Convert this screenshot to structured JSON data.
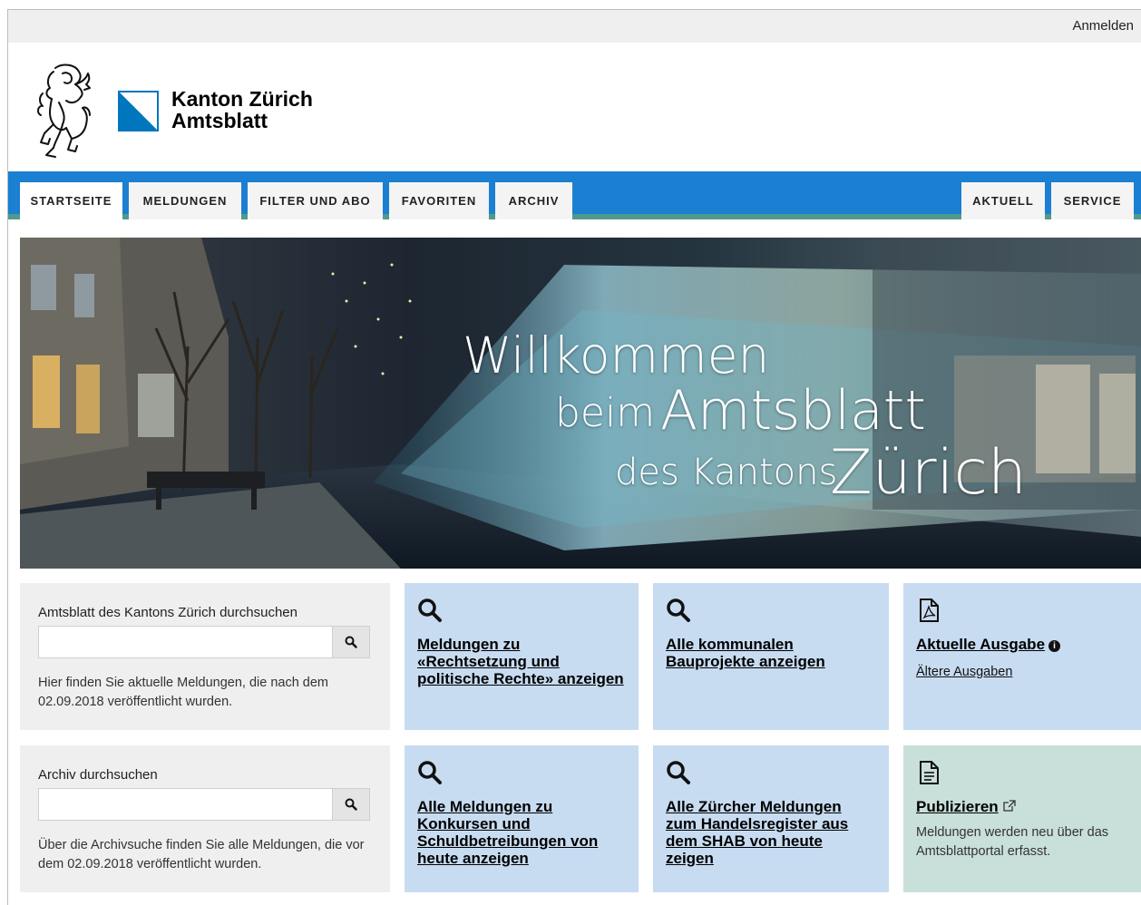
{
  "header": {
    "login_label": "Anmelden",
    "brand_line1": "Kanton Zürich",
    "brand_line2": "Amtsblatt"
  },
  "nav": {
    "left_tabs": [
      "STARTSEITE",
      "MELDUNGEN",
      "FILTER UND ABO",
      "FAVORITEN",
      "ARCHIV"
    ],
    "right_tabs": [
      "AKTUELL",
      "SERVICE"
    ],
    "active_tab": "STARTSEITE"
  },
  "hero": {
    "line1": "Willkommen",
    "line2a": "beim",
    "line2b": "Amtsblatt",
    "line3a": "des Kantons",
    "line3b": "Zürich"
  },
  "search_current": {
    "title": "Amtsblatt des Kantons Zürich durchsuchen",
    "input_value": "",
    "note": "Hier finden Sie aktuelle Meldungen, die nach dem 02.09.2018 veröffentlicht wurden."
  },
  "search_archive": {
    "title": "Archiv durchsuchen",
    "input_value": "",
    "note": "Über die Archivsuche finden Sie alle Meldungen, die vor dem 02.09.2018 veröffentlicht wurden."
  },
  "cards": {
    "rechtsetzung": "Meldungen zu «Rechtsetzung und politische Rechte» anzeigen",
    "bauprojekte": "Alle kommunalen Bauprojekte anzeigen",
    "aktuelle_ausgabe": "Aktuelle Ausgabe",
    "aeltere_ausgaben": "Ältere Ausgaben",
    "konkurse": "Alle Meldungen zu Konkursen und Schuldbetreibungen von heute anzeigen",
    "handelsregister": "Alle Zürcher Meldungen zum Handelsregister aus dem SHAB von heute zeigen",
    "publizieren": "Publizieren",
    "publizieren_note": "Meldungen werden neu über das Amtsblattportal erfasst."
  },
  "icons": {
    "search": "magnifier-icon",
    "pdf": "pdf-file-icon",
    "document": "document-icon",
    "external": "external-link-icon",
    "info": "info-icon"
  },
  "colors": {
    "nav_blue": "#1b7fd2",
    "nav_green_stripe": "#4f9a8c",
    "card_blue": "#c8dcf1",
    "card_green": "#c9e0da",
    "search_bg": "#efefef",
    "flag_blue": "#0076bd"
  }
}
